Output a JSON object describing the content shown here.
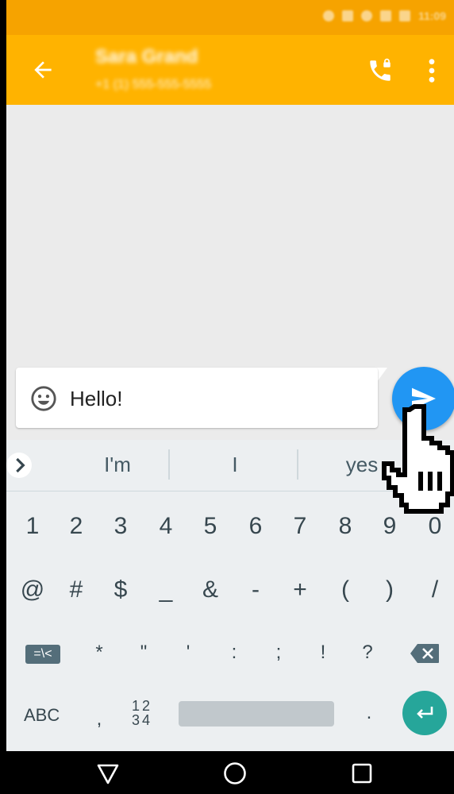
{
  "status_bar": {
    "time": "11:09"
  },
  "app_bar": {
    "contact_name": "Sara Grand",
    "contact_number": "+1 (1) 555-555-5555",
    "colors": {
      "status_bar": "#f6a300",
      "app_bar": "#ffb300"
    },
    "icons": [
      "back-arrow-icon",
      "secure-call-icon",
      "overflow-menu-icon"
    ]
  },
  "compose": {
    "text": "Hello!",
    "icons": [
      "emoji-icon",
      "send-icon"
    ],
    "send_color": "#2196f3"
  },
  "suggestions": [
    "I'm",
    "I",
    "yes"
  ],
  "keyboard": {
    "row_numbers": [
      "1",
      "2",
      "3",
      "4",
      "5",
      "6",
      "7",
      "8",
      "9",
      "0"
    ],
    "row_symbols1": [
      "@",
      "#",
      "$",
      "_",
      "&",
      "-",
      "+",
      "(",
      ")",
      "/"
    ],
    "symbols_toggle": "=\\<",
    "row_symbols2": [
      "*",
      "\"",
      "'",
      ":",
      ";",
      "!",
      "?"
    ],
    "abc": "ABC",
    "comma": ",",
    "numpad_top": "12",
    "numpad_bottom": "34",
    "period": ".",
    "enter_color": "#26a69a"
  },
  "nav_icons": [
    "back-triangle-icon",
    "home-circle-icon",
    "recents-square-icon"
  ]
}
